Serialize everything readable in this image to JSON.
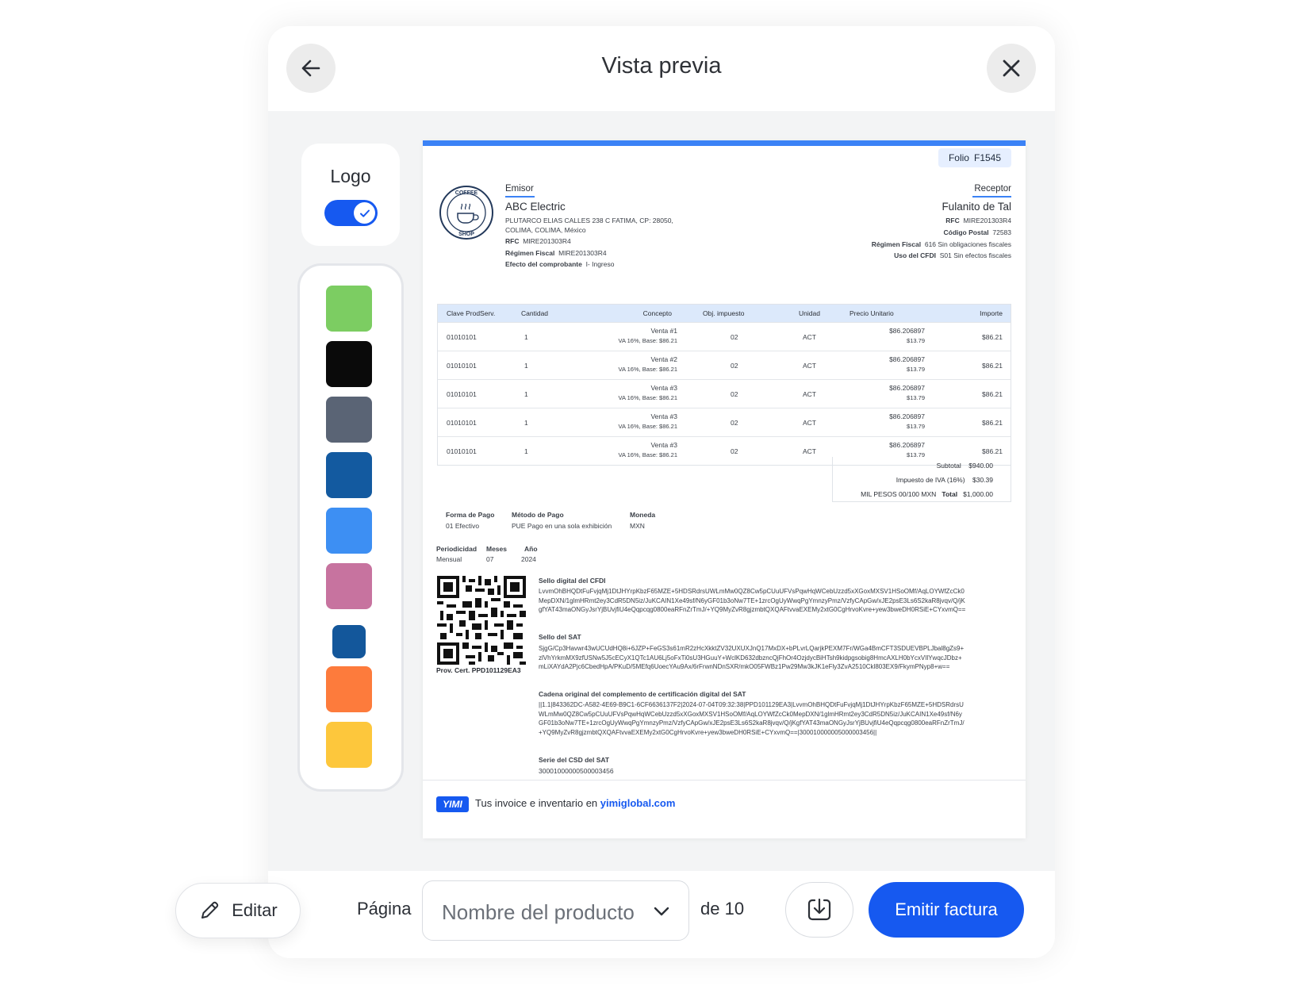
{
  "header": {
    "title": "Vista previa"
  },
  "sidebar": {
    "logo_label": "Logo",
    "logo_toggle_on": true,
    "swatches": [
      "#7ccd62",
      "#0a0a0a",
      "#5a6475",
      "#135aa0",
      "#3d8ff3",
      "#c7739f",
      "#13579b",
      "#fd7b3c",
      "#fdc73c"
    ]
  },
  "invoice": {
    "folio_label": "Folio",
    "folio_value": "F1545",
    "logo_text_top": "COFFEE",
    "logo_text_bottom": "SHOP",
    "emisor": {
      "heading": "Emisor",
      "name": "ABC Electric",
      "address1": "PLUTARCO ELIAS CALLES 238 C FATIMA, CP: 28050,",
      "address2": "COLIMA, COLIMA, México",
      "rfc_label": "RFC",
      "rfc": "MIRE201303R4",
      "regimen_label": "Régimen Fiscal",
      "regimen": "MIRE201303R4",
      "efecto_label": "Efecto del comprobante",
      "efecto": "I- Ingreso"
    },
    "receptor": {
      "heading": "Receptor",
      "name": "Fulanito de Tal",
      "rfc_label": "RFC",
      "rfc": "MIRE201303R4",
      "cp_label": "Código Postal",
      "cp": "72583",
      "regimen_label": "Régimen Fiscal",
      "regimen": "616 Sin obligaciones fiscales",
      "uso_label": "Uso del CFDI",
      "uso": "S01 Sin efectos fiscales"
    },
    "table": {
      "headers": [
        "Clave ProdServ.",
        "Cantidad",
        "Concepto",
        "Obj. impuesto",
        "Unidad",
        "Precio Unitario",
        "Importe"
      ],
      "rows": [
        {
          "clave": "01010101",
          "cantidad": "1",
          "concepto": "Venta #1",
          "concepto_sub": "VA 16%, Base: $86.21",
          "obj": "02",
          "unidad": "ACT",
          "precio": "$86.206897",
          "precio_sub": "$13.79",
          "importe": "$86.21"
        },
        {
          "clave": "01010101",
          "cantidad": "1",
          "concepto": "Venta #2",
          "concepto_sub": "VA 16%, Base: $86.21",
          "obj": "02",
          "unidad": "ACT",
          "precio": "$86.206897",
          "precio_sub": "$13.79",
          "importe": "$86.21"
        },
        {
          "clave": "01010101",
          "cantidad": "1",
          "concepto": "Venta #3",
          "concepto_sub": "VA 16%, Base: $86.21",
          "obj": "02",
          "unidad": "ACT",
          "precio": "$86.206897",
          "precio_sub": "$13.79",
          "importe": "$86.21"
        },
        {
          "clave": "01010101",
          "cantidad": "1",
          "concepto": "Venta #3",
          "concepto_sub": "VA 16%, Base: $86.21",
          "obj": "02",
          "unidad": "ACT",
          "precio": "$86.206897",
          "precio_sub": "$13.79",
          "importe": "$86.21"
        },
        {
          "clave": "01010101",
          "cantidad": "1",
          "concepto": "Venta #3",
          "concepto_sub": "VA 16%, Base: $86.21",
          "obj": "02",
          "unidad": "ACT",
          "precio": "$86.206897",
          "precio_sub": "$13.79",
          "importe": "$86.21"
        }
      ]
    },
    "totals": {
      "subtotal_label": "Subtotal",
      "subtotal": "$940.00",
      "iva_label": "Impuesto de IVA (16%)",
      "iva": "$30.39",
      "words": "MIL PESOS 00/100 MXN",
      "total_label": "Total",
      "total": "$1,000.00"
    },
    "payment": {
      "forma_label": "Forma de Pago",
      "forma": "01 Efectivo",
      "metodo_label": "Método de Pago",
      "metodo": "PUE Pago en una sola exhibición",
      "moneda_label": "Moneda",
      "moneda": "MXN",
      "periodicidad_label": "Periodicidad",
      "periodicidad": "Mensual",
      "meses_label": "Meses",
      "meses": "07",
      "anio_label": "Año",
      "anio": "2024"
    },
    "cert_label": "Prov. Cert. PPD101129EA3",
    "sello_cfdi_label": "Sello digital del CFDI",
    "sello_cfdi": "LvvmOhBHQDtFuFvjqMj1DtJHYrpKbzF65MZE+5HDSRdrsUWLmMw0QZ8Cw5pCUuUFVsPqwHqWCebUzzd5xXGoxMXSV1HSoOMf/AqLOYWfZcCk0MepDXN/1glmHRmt2ey3CdR5DN5iz/JuKCAIN1Xe49sf/N6yGF01b3oNw7TE+1zrcOgUyWwqPgYmnzyPmz/VzfyCApGw/xJE2psE3Ls6S2kaR8jvqv/Q/jKgfYAT43maONGyJsrYjBUvjfiU4eQqpcqg0800eaRFnZrTmJ/+YQ9MyZvR8gjzmbtQXQAFtvvaEXEMy2xtG0CgHrvoKvre+yew3bweDH0RSiE+CYxvmQ==",
    "sello_sat_label": "Sello del SAT",
    "sello_sat": "SjgG/Cp3Havwr43wUCUdHQ8i+6JZP+FeGS3s61mR2zHcXkktZV32UXUXJnQ17MxDX+bPLvrLQarjkPEXM7Fr/WGa4BmCFT3SDUEVBPLJbal8gZs9+zlVhYrkmMX9zfUSNw5J5cECyX1QTc1AU6Lj5oFxTi0sU3HGuuY+WclKD632dbzncQjFhOr4OzjdycBiHTsh9kidpgsobig8HmcAXLH0bYcxVIlYwqcJDbz+mLiXAYdA2Pjc6CbedHpA/PKuD/5MEfq6UoecYAu9Ax/6rFrwnNDnSXR/mkO05FWBz1Pw29Mw3kJK1eFly3ZvA2510Ckl803EX9/FkymPNyp8+w==",
    "cadena_label": "Cadena original del complemento de certificación digital del SAT",
    "cadena": "||1.1|843362DC-A582-4E69-B9C1-6CF6636137F2|2024-07-04T09:32:38|PPD101129EA3|LvvmOhBHQDtFuFvjqMj1DtJHYrpKbzF65MZE+5HDSRdrsUWLmMw0QZ8Cw5pCUuUFVsPqwHqWCebUzzd5xXGoxMXSV1HSoOMf/AqLOYWfZcCk0MepDXN/1glmHRmt2ey3CdR5DN5iz/JuKCAIN1Xe49sf/N6yGF01b3oNw7TE+1zrcOgUyWwqPgYmnzyPmz/VzfyCApGw/xJE2psE3Ls6S2kaR8jvqv/Q/jKgfYAT43maONGyJsrYjBUvjfiU4eQqpcqg0800eaRFnZrTmJ/+YQ9MyZvR8gjzmbtQXQAFtvvaEXEMy2xtG0CgHrvoKvre+yew3bweDH0RSiE+CYxvmQ==|300010000005000003456||",
    "serie_label": "Serie del CSD del SAT",
    "serie": "30001000000500003456",
    "footer_badge": "YIMI",
    "footer_text": "Tus invoice e inventario en ",
    "footer_link": "yimiglobal.com"
  },
  "toolbar": {
    "edit_label": "Editar",
    "page_label": "Página",
    "select_value": "Nombre del producto",
    "of_label": "de 10",
    "emit_label": "Emitir factura"
  }
}
